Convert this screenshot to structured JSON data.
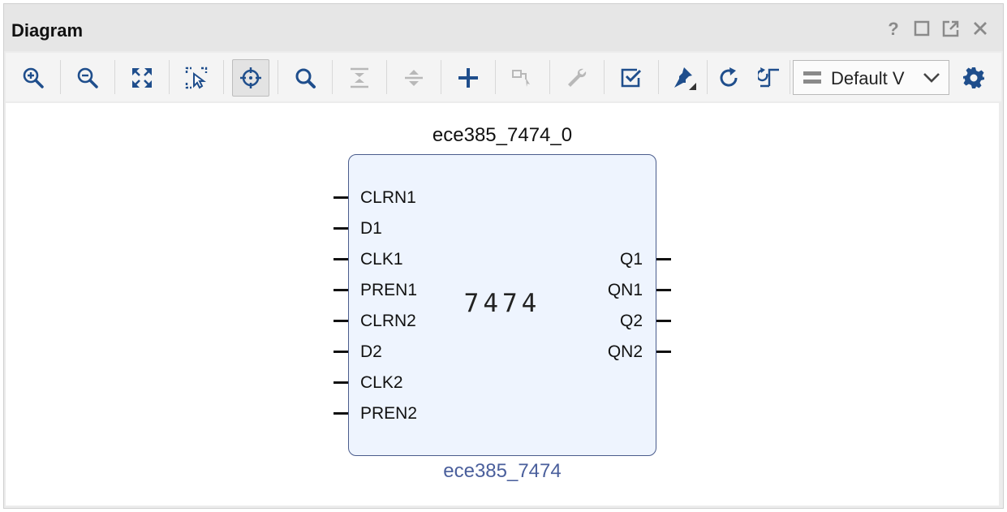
{
  "window": {
    "title": "Diagram",
    "controls": [
      "help-icon",
      "maximize-icon",
      "float-icon",
      "close-icon"
    ]
  },
  "toolbar": {
    "buttons": [
      {
        "icon": "zoom-in-icon"
      },
      {
        "icon": "zoom-out-icon"
      },
      {
        "icon": "fit-icon"
      },
      {
        "icon": "zoom-area-icon"
      },
      {
        "icon": "auto-fit-icon",
        "selected": true
      },
      {
        "icon": "search-icon"
      },
      {
        "icon": "collapse-icon",
        "disabled": true
      },
      {
        "icon": "expand-icon",
        "disabled": true
      },
      {
        "icon": "add-icon"
      },
      {
        "icon": "make-connection-icon",
        "disabled": true
      },
      {
        "icon": "wrench-icon",
        "disabled": true
      },
      {
        "icon": "validate-icon"
      },
      {
        "icon": "pin-icon"
      },
      {
        "icon": "refresh-icon"
      },
      {
        "icon": "regenerate-layout-icon"
      }
    ],
    "view_dropdown": {
      "value": "Default V",
      "icon": "view-layers-icon"
    },
    "settings_icon": "gear-icon"
  },
  "diagram": {
    "instance_name": "ece385_7474_0",
    "block_label": "7474",
    "module_name": "ece385_7474",
    "inputs": [
      "CLRN1",
      "D1",
      "CLK1",
      "PREN1",
      "CLRN2",
      "D2",
      "CLK2",
      "PREN2"
    ],
    "outputs": [
      "Q1",
      "QN1",
      "Q2",
      "QN2"
    ]
  },
  "colors": {
    "block_fill": "#eef4fe",
    "block_border": "#4a5c8c",
    "module_name_text": "#4a5f9c",
    "icon_blue": "#1f4e8c",
    "icon_disabled": "#b8b8b8"
  }
}
